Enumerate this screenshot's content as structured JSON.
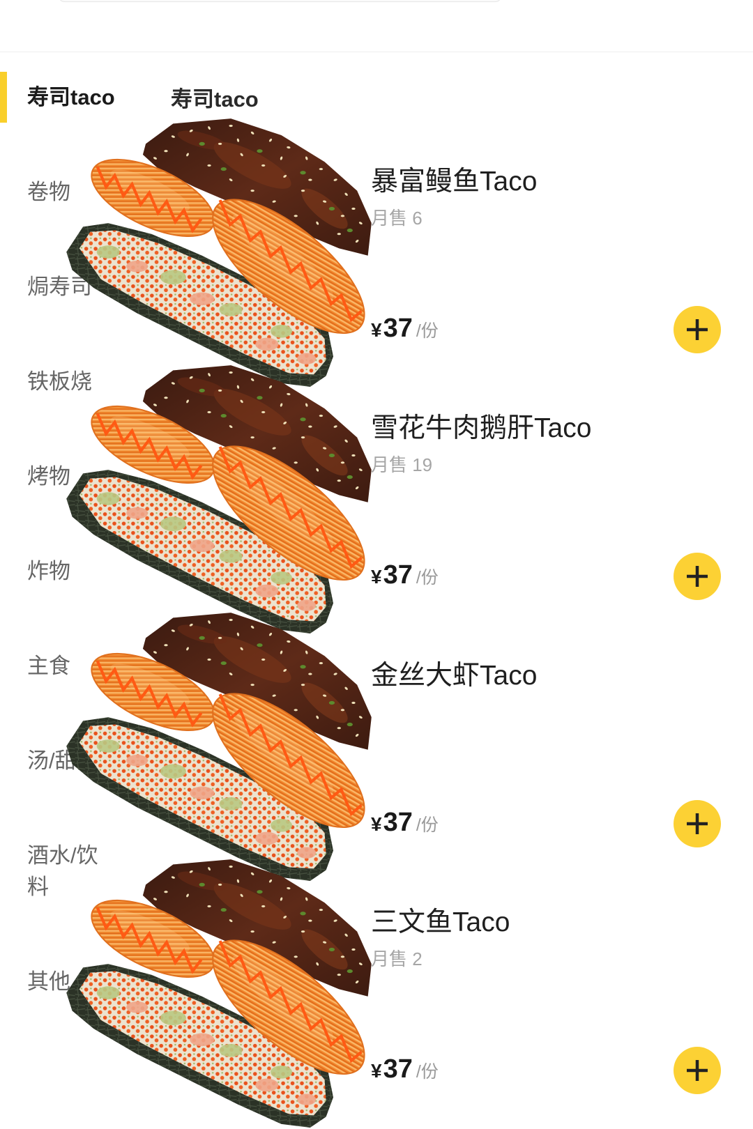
{
  "colors": {
    "accent": "#F9CF2B",
    "add_button": "#FCD134",
    "text_primary": "#1F1F1F",
    "text_secondary": "#666666",
    "text_muted": "#A6A6A6"
  },
  "sidebar": {
    "categories": [
      {
        "label": "寿司taco",
        "selected": true
      },
      {
        "label": "卷物",
        "selected": false
      },
      {
        "label": "焗寿司",
        "selected": false
      },
      {
        "label": "铁板烧",
        "selected": false
      },
      {
        "label": "烤物",
        "selected": false
      },
      {
        "label": "炸物",
        "selected": false
      },
      {
        "label": "主食",
        "selected": false
      },
      {
        "label": "汤/甜品",
        "selected": false
      },
      {
        "label": "酒水/饮料",
        "selected": false
      },
      {
        "label": "其他",
        "selected": false
      }
    ]
  },
  "section": {
    "title": "寿司taco"
  },
  "products": [
    {
      "name": "暴富鳗鱼Taco",
      "sales": "月售 6",
      "currency": "¥",
      "price": "37",
      "unit": "/份",
      "add_icon": "plus-icon"
    },
    {
      "name": "雪花牛肉鹅肝Taco",
      "sales": "月售 19",
      "currency": "¥",
      "price": "37",
      "unit": "/份",
      "add_icon": "plus-icon"
    },
    {
      "name": "金丝大虾Taco",
      "sales": "",
      "currency": "¥",
      "price": "37",
      "unit": "/份",
      "add_icon": "plus-icon"
    },
    {
      "name": "三文鱼Taco",
      "sales": "月售 2",
      "currency": "¥",
      "price": "37",
      "unit": "/份",
      "add_icon": "plus-icon"
    }
  ]
}
